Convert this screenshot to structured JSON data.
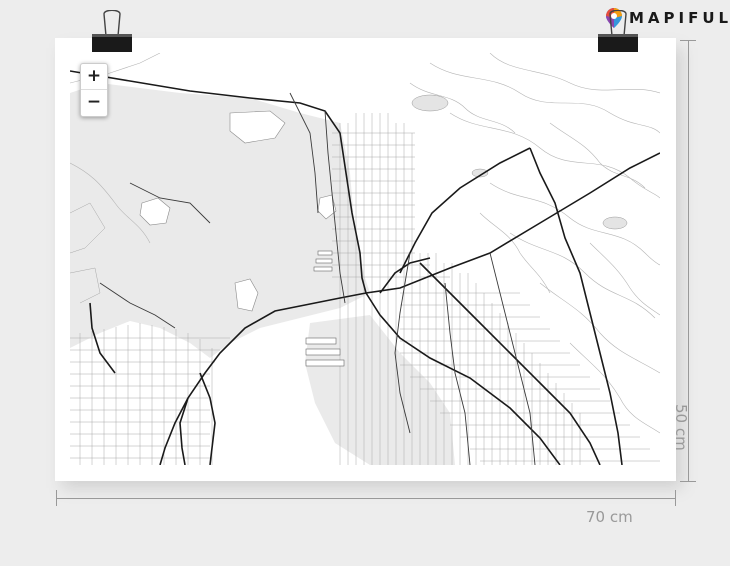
{
  "brand": {
    "name": "MAPIFUL",
    "colors": [
      "#e74c3c",
      "#f39c12",
      "#3498db",
      "#2c3e50"
    ]
  },
  "map": {
    "zoom_in_label": "+",
    "zoom_out_label": "−",
    "style": "monochrome-light",
    "colors": {
      "water": "#eaeaea",
      "land": "#ffffff",
      "roads": "#1a1a1a",
      "streets": "#9a9a9a"
    }
  },
  "dimensions": {
    "width_label": "70 cm",
    "height_label": "50 cm"
  }
}
